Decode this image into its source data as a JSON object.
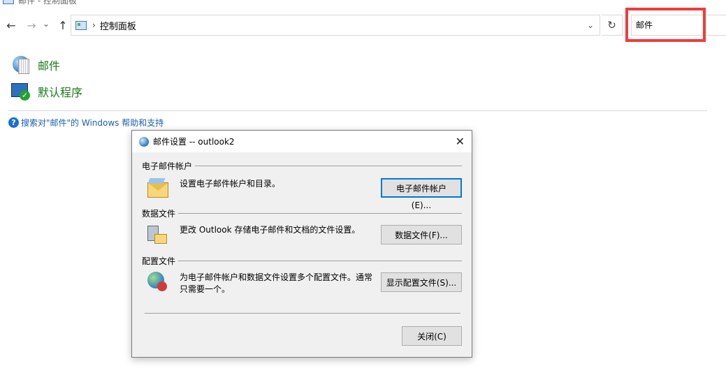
{
  "window": {
    "title": "邮件 - 控制面板"
  },
  "nav": {
    "back_icon": "←",
    "forward_icon": "→",
    "recent_icon": "⌄",
    "up_icon": "↑",
    "address_separator": "›",
    "address_path": "控制面板",
    "dropdown_icon": "⌄",
    "refresh_icon": "↻",
    "search_value": "邮件"
  },
  "results": [
    {
      "label": "邮件",
      "icon": "mail-settings-icon"
    },
    {
      "label": "默认程序",
      "icon": "default-programs-icon"
    }
  ],
  "help_link": {
    "icon": "?",
    "text": "搜索对\"邮件\"的 Windows 帮助和支持"
  },
  "dialog": {
    "title": "邮件设置 --  outlook2",
    "close_icon": "✕",
    "sections": [
      {
        "heading": "电子邮件帐户",
        "text": "设置电子邮件帐户和目录。",
        "button": "电子邮件帐户(E)..."
      },
      {
        "heading": "数据文件",
        "text": "更改 Outlook 存储电子邮件和文档的文件设置。",
        "button": "数据文件(F)..."
      },
      {
        "heading": "配置文件",
        "text": "为电子邮件帐户和数据文件设置多个配置文件。通常只需要一个。",
        "button": "显示配置文件(S)..."
      }
    ],
    "close_button": "关闭(C)"
  },
  "colors": {
    "highlight": "#f23b3b",
    "link": "#1a5fb4",
    "result_label": "#1a7a1a"
  }
}
